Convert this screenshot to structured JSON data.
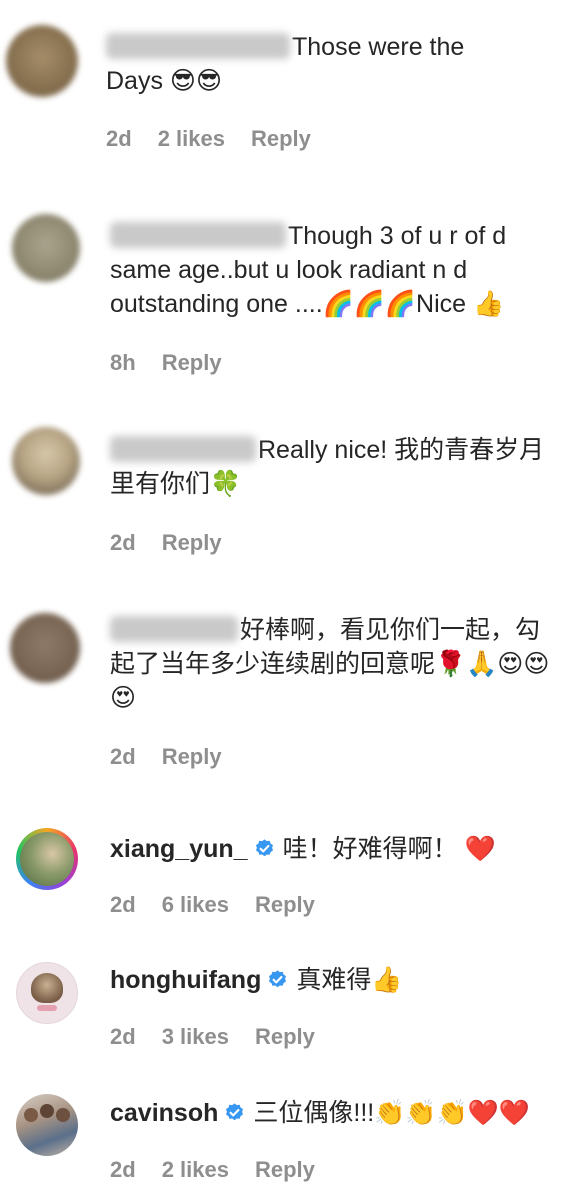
{
  "comments": [
    {
      "text_line1": "Those were the",
      "text_line2": "Days 😎😎",
      "time": "2d",
      "likes": "2 likes",
      "reply": "Reply"
    },
    {
      "text": "Though 3 of u r of d same age..but u look radiant n d outstanding one ....🌈🌈🌈Nice 👍",
      "time": "8h",
      "reply": "Reply"
    },
    {
      "text": "Really nice! 我的青春岁月里有你们🍀",
      "time": "2d",
      "reply": "Reply"
    },
    {
      "text": "好棒啊，看见你们一起，勾起了当年多少连续剧的回意呢🌹🙏😍😍😍",
      "time": "2d",
      "reply": "Reply"
    },
    {
      "username": "xiang_yun_",
      "text": "哇！好难得啊！ ❤️",
      "time": "2d",
      "likes": "6 likes",
      "reply": "Reply"
    },
    {
      "username": "honghuifang",
      "text": "真难得👍",
      "time": "2d",
      "likes": "3 likes",
      "reply": "Reply"
    },
    {
      "username": "cavinsoh",
      "text": "三位偶像!!!👏👏👏❤️❤️",
      "time": "2d",
      "likes": "2 likes",
      "reply": "Reply"
    }
  ],
  "colors": {
    "text": "#262626",
    "meta": "#8e8e8e",
    "verified": "#3897f0"
  }
}
